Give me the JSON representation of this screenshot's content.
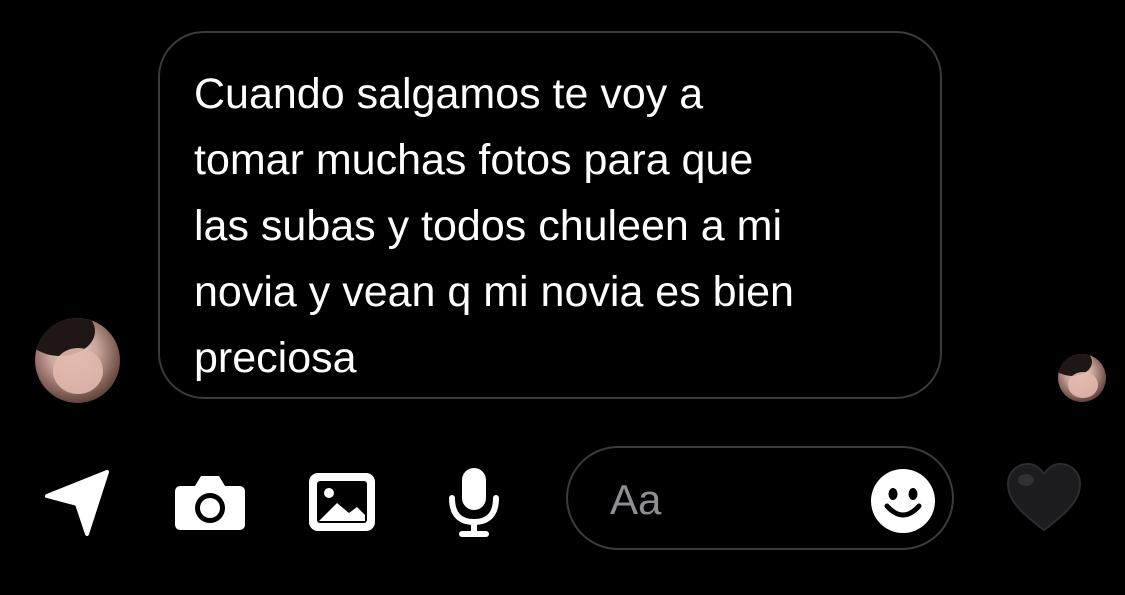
{
  "message": {
    "text": "Cuando salgamos te voy a\ntomar muchas fotos para que\nlas subas y todos chuleen a mi\nnovia y vean q mi novia es bien\npreciosa"
  },
  "composer": {
    "placeholder": "Aa"
  },
  "toolbar": {
    "icons": [
      "send-location-icon",
      "camera-icon",
      "gallery-icon",
      "microphone-icon",
      "emoji-icon",
      "heart-icon"
    ]
  },
  "colors": {
    "background": "#000000",
    "bubble_border": "#3b3b3d",
    "text": "#ffffff",
    "placeholder": "#8e8e93",
    "heart": "#1c1c1e"
  }
}
